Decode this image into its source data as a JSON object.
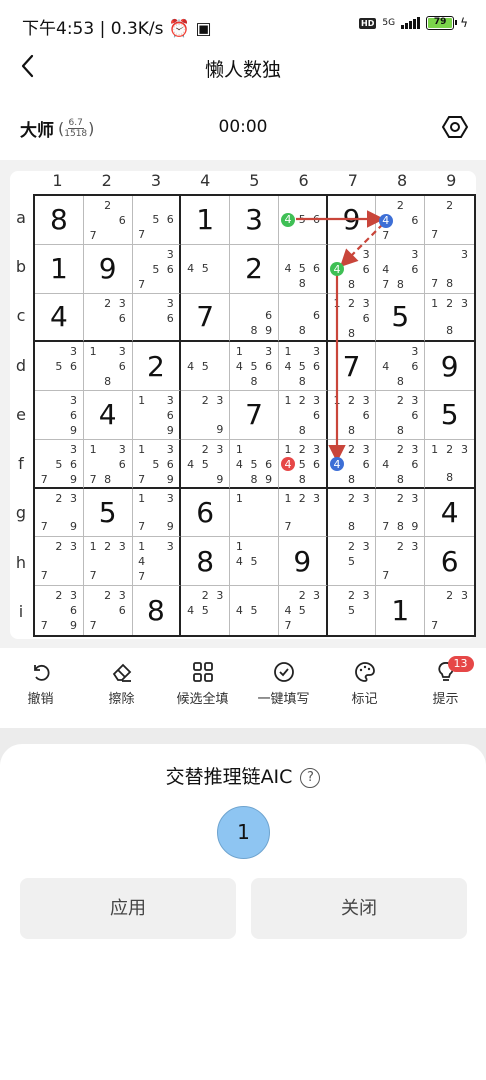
{
  "status_bar": {
    "time": "下午4:53",
    "speed": "0.3K/s",
    "network": "5G",
    "hd": "HD",
    "battery": "79"
  },
  "nav": {
    "title": "懒人数独"
  },
  "info": {
    "level": "大师",
    "rating_top": "6.7",
    "rating_bottom": "1518",
    "timer": "00:00"
  },
  "columns": [
    "1",
    "2",
    "3",
    "4",
    "5",
    "6",
    "7",
    "8",
    "9"
  ],
  "rows": [
    "a",
    "b",
    "c",
    "d",
    "e",
    "f",
    "g",
    "h",
    "i"
  ],
  "grid": [
    [
      "8",
      "2 6 7",
      "5 6 7",
      "1",
      "3",
      "4 5 6",
      "9",
      "2 4 6 7",
      "2 7"
    ],
    [
      "1",
      "9",
      "3 5 6 7",
      "4 5",
      "2",
      "4 5 6 8",
      "3 4 6 8",
      "3 4 6 7 8",
      "3 7 8"
    ],
    [
      "4",
      "2 3 6",
      "3 6",
      "7",
      "6 8 9",
      "6 8",
      "1 2 3 6 8",
      "5",
      "1 2 3 8"
    ],
    [
      "3 5 6",
      "1 3 6 8",
      "2",
      "4 5",
      "1 3 4 5 6 8",
      "1 3 4 5 6 8",
      "7",
      "3 4 6 8",
      "9"
    ],
    [
      "3 6 9",
      "4",
      "1 3 6 9",
      "2 3 9",
      "7",
      "1 2 3 6 8",
      "1 2 3 6 8",
      "2 3 6 8",
      "5"
    ],
    [
      "3 5 6 7 9",
      "1 3 6 7 8",
      "1 3 5 6 7 9",
      "2 3 4 5 9",
      "1 4 5 6 8 9",
      "1 2 3 4 5 6 8",
      "2 3 4 6 8",
      "2 3 4 6 8",
      "1 2 3 8"
    ],
    [
      "2 3 7 9",
      "5",
      "1 3 7 9",
      "6",
      "1",
      "1 2 3 7",
      "2 3 8",
      "2 3 7 8 9",
      "4"
    ],
    [
      "2 3 7",
      "1 2 3 7",
      "1 3 4 7",
      "8",
      "1 4 5",
      "9",
      "2 3 5",
      "2 3 7",
      "6"
    ],
    [
      "2 3 6 7 9",
      "2 3 6 7",
      "8",
      "2 3 4 5",
      "4 5",
      "2 3 4 5 7",
      "2 3 5",
      "1",
      "2 3 7"
    ]
  ],
  "givens": [
    [
      true,
      false,
      false,
      true,
      true,
      false,
      true,
      false,
      false
    ],
    [
      true,
      true,
      false,
      false,
      true,
      false,
      false,
      false,
      false
    ],
    [
      true,
      false,
      false,
      true,
      false,
      false,
      false,
      true,
      false
    ],
    [
      false,
      false,
      true,
      false,
      false,
      false,
      true,
      false,
      true
    ],
    [
      false,
      true,
      false,
      false,
      true,
      false,
      false,
      false,
      true
    ],
    [
      false,
      false,
      false,
      false,
      false,
      false,
      false,
      false,
      false
    ],
    [
      false,
      true,
      false,
      true,
      false,
      false,
      false,
      false,
      true
    ],
    [
      false,
      false,
      false,
      true,
      false,
      true,
      false,
      false,
      true
    ],
    [
      false,
      false,
      true,
      false,
      false,
      false,
      false,
      true,
      false
    ]
  ],
  "highlights": [
    {
      "cell": "a6",
      "digit": "4",
      "color": "#3fbf55"
    },
    {
      "cell": "a8",
      "digit": "4",
      "color": "#3d6fd6"
    },
    {
      "cell": "b7",
      "digit": "4",
      "color": "#3fbf55"
    },
    {
      "cell": "f6",
      "digit": "4",
      "color": "#e64747"
    },
    {
      "cell": "f7",
      "digit": "4",
      "color": "#3d6fd6"
    }
  ],
  "chain_color": "#c9453a",
  "toolbar": {
    "undo": "撤销",
    "erase": "擦除",
    "fill_candidates": "候选全填",
    "one_click_fill": "一键填写",
    "mark": "标记",
    "hint": "提示",
    "hint_count": "13"
  },
  "sheet": {
    "title": "交替推理链AIC",
    "help": "?",
    "step": "1",
    "apply": "应用",
    "close": "关闭"
  }
}
